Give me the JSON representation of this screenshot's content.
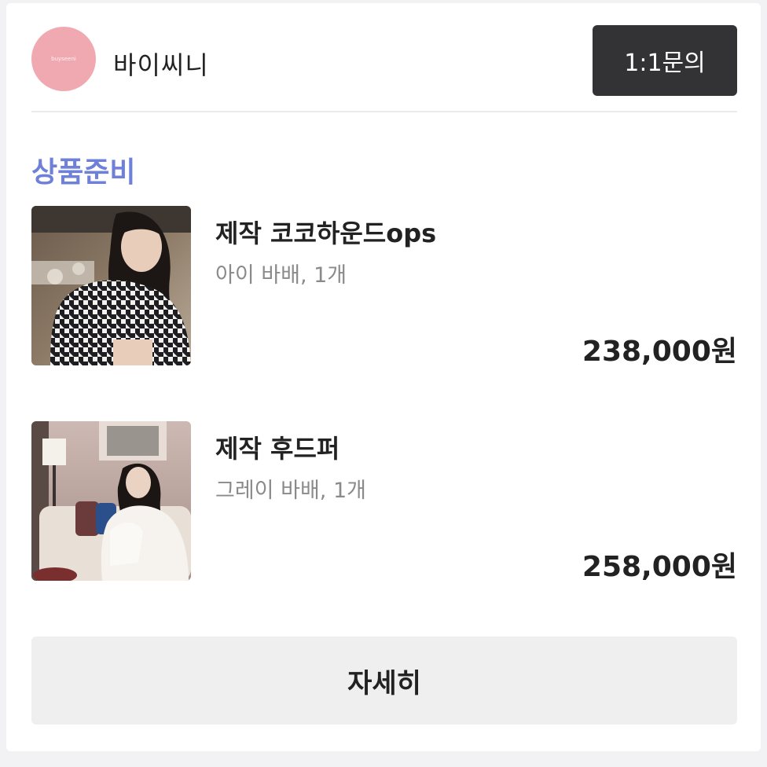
{
  "shop": {
    "name": "바이씨니",
    "avatar_color": "#f1a9b1",
    "inquiry_label": "1:1문의"
  },
  "section_title": "상품준비",
  "accent_color": "#6f80d8",
  "products": [
    {
      "name": "제작 코코하운드ops",
      "option": "아이 바배, 1개",
      "price": "238,000원",
      "image": "houndstooth-dress-photo"
    },
    {
      "name": "제작 후드퍼",
      "option": "그레이 바배, 1개",
      "price": "258,000원",
      "image": "white-fur-coat-photo"
    }
  ],
  "detail_label": "자세히"
}
